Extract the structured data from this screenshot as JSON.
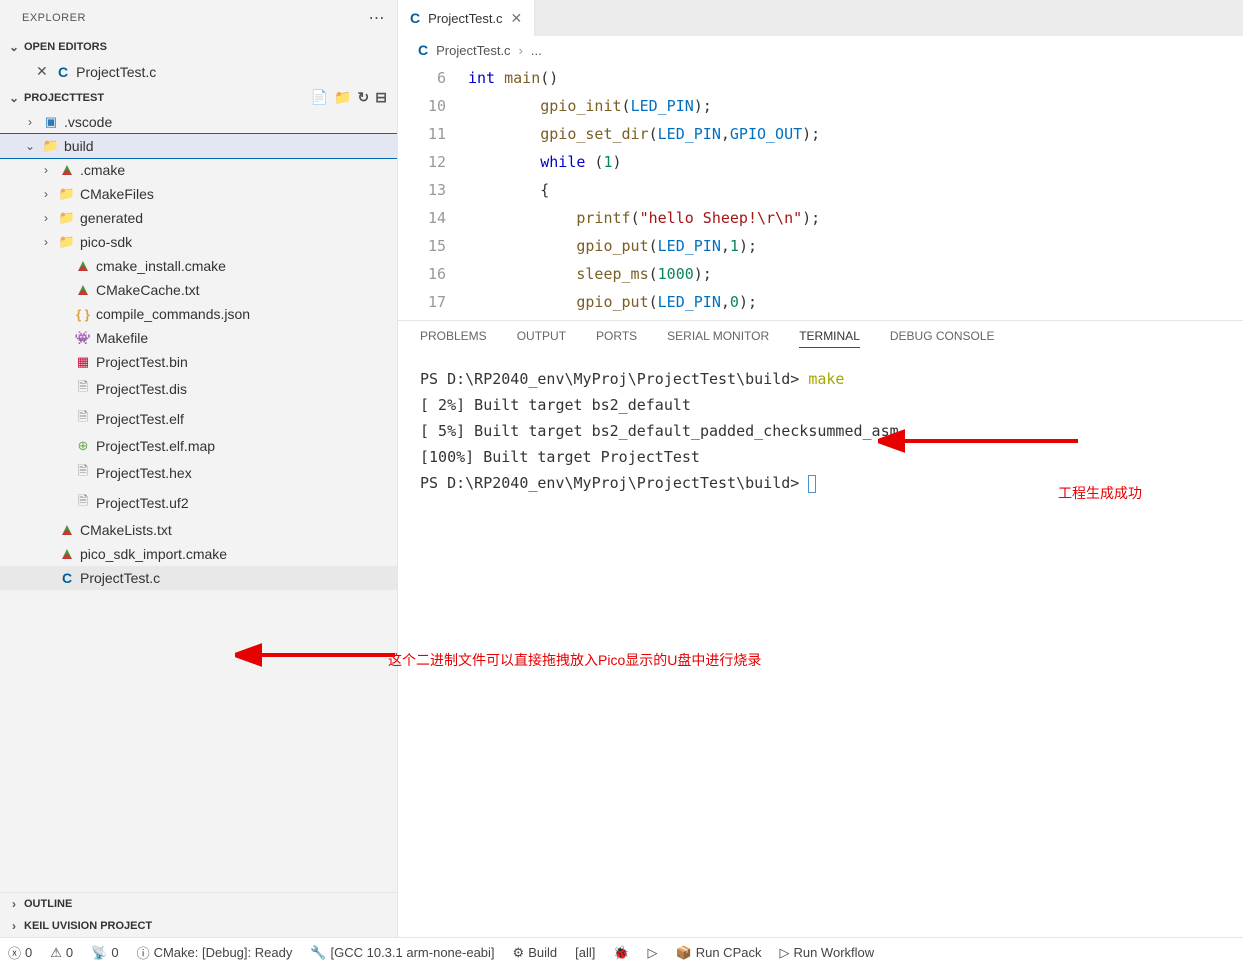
{
  "sidebar": {
    "title": "EXPLORER",
    "openEditors": {
      "title": "OPEN EDITORS",
      "items": [
        {
          "name": "ProjectTest.c"
        }
      ]
    },
    "project": {
      "title": "PROJECTTEST",
      "tree": [
        {
          "label": ".vscode",
          "type": "folder",
          "icon": "vscode",
          "expanded": false,
          "depth": 1
        },
        {
          "label": "build",
          "type": "folder",
          "icon": "folder",
          "expanded": true,
          "depth": 1,
          "selected": true
        },
        {
          "label": ".cmake",
          "type": "folder",
          "icon": "cmake",
          "expanded": false,
          "depth": 2
        },
        {
          "label": "CMakeFiles",
          "type": "folder",
          "icon": "folder",
          "expanded": false,
          "depth": 2
        },
        {
          "label": "generated",
          "type": "folder",
          "icon": "folder",
          "expanded": false,
          "depth": 2
        },
        {
          "label": "pico-sdk",
          "type": "folder",
          "icon": "folder",
          "expanded": false,
          "depth": 2
        },
        {
          "label": "cmake_install.cmake",
          "type": "file",
          "icon": "cmake",
          "depth": 3
        },
        {
          "label": "CMakeCache.txt",
          "type": "file",
          "icon": "cmake",
          "depth": 3
        },
        {
          "label": "compile_commands.json",
          "type": "file",
          "icon": "braces",
          "depth": 3
        },
        {
          "label": "Makefile",
          "type": "file",
          "icon": "makefile",
          "depth": 3
        },
        {
          "label": "ProjectTest.bin",
          "type": "file",
          "icon": "bin",
          "depth": 3
        },
        {
          "label": "ProjectTest.dis",
          "type": "file",
          "icon": "file",
          "depth": 3
        },
        {
          "label": "ProjectTest.elf",
          "type": "file",
          "icon": "file",
          "depth": 3
        },
        {
          "label": "ProjectTest.elf.map",
          "type": "file",
          "icon": "map",
          "depth": 3
        },
        {
          "label": "ProjectTest.hex",
          "type": "file",
          "icon": "file",
          "depth": 3
        },
        {
          "label": "ProjectTest.uf2",
          "type": "file",
          "icon": "file",
          "depth": 3
        },
        {
          "label": "CMakeLists.txt",
          "type": "file",
          "icon": "cmake",
          "depth": 2
        },
        {
          "label": "pico_sdk_import.cmake",
          "type": "file",
          "icon": "cmake",
          "depth": 2
        },
        {
          "label": "ProjectTest.c",
          "type": "file",
          "icon": "c",
          "depth": 2,
          "active": true
        }
      ]
    },
    "outline": "OUTLINE",
    "keil": "KEIL UVISION PROJECT"
  },
  "editor": {
    "tab": "ProjectTest.c",
    "breadcrumb": {
      "file": "ProjectTest.c",
      "rest": "..."
    },
    "lines": [
      {
        "n": 6,
        "tokens": [
          [
            "kw",
            "int"
          ],
          [
            "",
            " "
          ],
          [
            "fn",
            "main"
          ],
          [
            "",
            "()"
          ]
        ]
      },
      {
        "n": 10,
        "tokens": [
          [
            "",
            "        "
          ],
          [
            "fn",
            "gpio_init"
          ],
          [
            "",
            "("
          ],
          [
            "const",
            "LED_PIN"
          ],
          [
            "",
            ");"
          ]
        ]
      },
      {
        "n": 11,
        "tokens": [
          [
            "",
            "        "
          ],
          [
            "fn",
            "gpio_set_dir"
          ],
          [
            "",
            "("
          ],
          [
            "const",
            "LED_PIN"
          ],
          [
            "",
            ","
          ],
          [
            "const",
            "GPIO_OUT"
          ],
          [
            "",
            ");"
          ]
        ]
      },
      {
        "n": 12,
        "tokens": [
          [
            "",
            "        "
          ],
          [
            "kw",
            "while"
          ],
          [
            "",
            " ("
          ],
          [
            "num",
            "1"
          ],
          [
            "",
            ")"
          ]
        ]
      },
      {
        "n": 13,
        "tokens": [
          [
            "",
            "        {"
          ]
        ]
      },
      {
        "n": 14,
        "tokens": [
          [
            "",
            "            "
          ],
          [
            "fn",
            "printf"
          ],
          [
            "",
            "("
          ],
          [
            "str",
            "\"hello Sheep!\\r\\n\""
          ],
          [
            "",
            ");"
          ]
        ]
      },
      {
        "n": 15,
        "tokens": [
          [
            "",
            "            "
          ],
          [
            "fn",
            "gpio_put"
          ],
          [
            "",
            "("
          ],
          [
            "const",
            "LED_PIN"
          ],
          [
            "",
            ","
          ],
          [
            "num",
            "1"
          ],
          [
            "",
            ");"
          ]
        ]
      },
      {
        "n": 16,
        "tokens": [
          [
            "",
            "            "
          ],
          [
            "fn",
            "sleep_ms"
          ],
          [
            "",
            "("
          ],
          [
            "num",
            "1000"
          ],
          [
            "",
            ");"
          ]
        ]
      },
      {
        "n": 17,
        "tokens": [
          [
            "",
            "            "
          ],
          [
            "fn",
            "gpio_put"
          ],
          [
            "",
            "("
          ],
          [
            "const",
            "LED_PIN"
          ],
          [
            "",
            ","
          ],
          [
            "num",
            "0"
          ],
          [
            "",
            ");"
          ]
        ]
      }
    ]
  },
  "panel": {
    "tabs": [
      "PROBLEMS",
      "OUTPUT",
      "PORTS",
      "SERIAL MONITOR",
      "TERMINAL",
      "DEBUG CONSOLE"
    ],
    "active": "TERMINAL",
    "terminal": {
      "prompt1": "PS D:\\RP2040_env\\MyProj\\ProjectTest\\build>",
      "cmd": "make",
      "lines": [
        "[  2%] Built target bs2_default",
        "[  5%] Built target bs2_default_padded_checksummed_asm",
        "[100%] Built target ProjectTest"
      ],
      "prompt2": "PS D:\\RP2040_env\\MyProj\\ProjectTest\\build>"
    }
  },
  "annotations": {
    "uf2": "这个二进制文件可以直接拖拽放入Pico显示的U盘中进行烧录",
    "build": "工程生成成功"
  },
  "statusbar": {
    "errors": "0",
    "warnings": "0",
    "ports": "0",
    "cmake": "CMake: [Debug]: Ready",
    "gcc": "[GCC 10.3.1 arm-none-eabi]",
    "build": "Build",
    "target": "[all]",
    "cpack": "Run CPack",
    "workflow": "Run Workflow"
  }
}
